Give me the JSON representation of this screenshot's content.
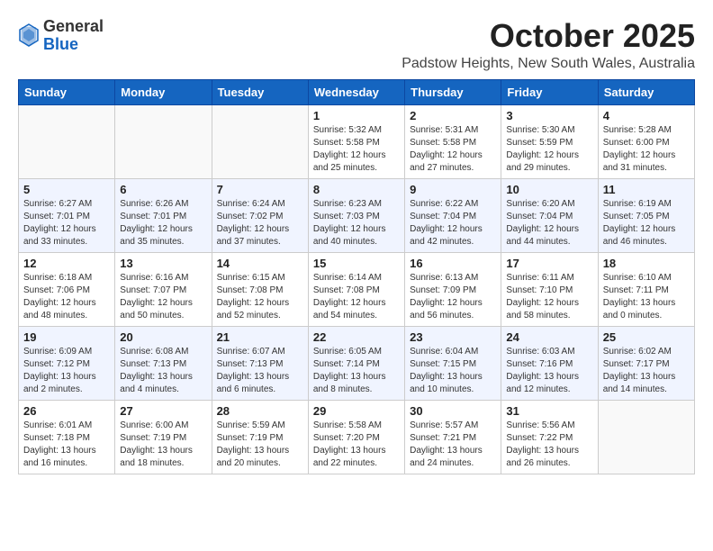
{
  "header": {
    "logo_general": "General",
    "logo_blue": "Blue",
    "month": "October 2025",
    "location": "Padstow Heights, New South Wales, Australia"
  },
  "weekdays": [
    "Sunday",
    "Monday",
    "Tuesday",
    "Wednesday",
    "Thursday",
    "Friday",
    "Saturday"
  ],
  "weeks": [
    [
      {
        "day": "",
        "info": ""
      },
      {
        "day": "",
        "info": ""
      },
      {
        "day": "",
        "info": ""
      },
      {
        "day": "1",
        "info": "Sunrise: 5:32 AM\nSunset: 5:58 PM\nDaylight: 12 hours\nand 25 minutes."
      },
      {
        "day": "2",
        "info": "Sunrise: 5:31 AM\nSunset: 5:58 PM\nDaylight: 12 hours\nand 27 minutes."
      },
      {
        "day": "3",
        "info": "Sunrise: 5:30 AM\nSunset: 5:59 PM\nDaylight: 12 hours\nand 29 minutes."
      },
      {
        "day": "4",
        "info": "Sunrise: 5:28 AM\nSunset: 6:00 PM\nDaylight: 12 hours\nand 31 minutes."
      }
    ],
    [
      {
        "day": "5",
        "info": "Sunrise: 6:27 AM\nSunset: 7:01 PM\nDaylight: 12 hours\nand 33 minutes."
      },
      {
        "day": "6",
        "info": "Sunrise: 6:26 AM\nSunset: 7:01 PM\nDaylight: 12 hours\nand 35 minutes."
      },
      {
        "day": "7",
        "info": "Sunrise: 6:24 AM\nSunset: 7:02 PM\nDaylight: 12 hours\nand 37 minutes."
      },
      {
        "day": "8",
        "info": "Sunrise: 6:23 AM\nSunset: 7:03 PM\nDaylight: 12 hours\nand 40 minutes."
      },
      {
        "day": "9",
        "info": "Sunrise: 6:22 AM\nSunset: 7:04 PM\nDaylight: 12 hours\nand 42 minutes."
      },
      {
        "day": "10",
        "info": "Sunrise: 6:20 AM\nSunset: 7:04 PM\nDaylight: 12 hours\nand 44 minutes."
      },
      {
        "day": "11",
        "info": "Sunrise: 6:19 AM\nSunset: 7:05 PM\nDaylight: 12 hours\nand 46 minutes."
      }
    ],
    [
      {
        "day": "12",
        "info": "Sunrise: 6:18 AM\nSunset: 7:06 PM\nDaylight: 12 hours\nand 48 minutes."
      },
      {
        "day": "13",
        "info": "Sunrise: 6:16 AM\nSunset: 7:07 PM\nDaylight: 12 hours\nand 50 minutes."
      },
      {
        "day": "14",
        "info": "Sunrise: 6:15 AM\nSunset: 7:08 PM\nDaylight: 12 hours\nand 52 minutes."
      },
      {
        "day": "15",
        "info": "Sunrise: 6:14 AM\nSunset: 7:08 PM\nDaylight: 12 hours\nand 54 minutes."
      },
      {
        "day": "16",
        "info": "Sunrise: 6:13 AM\nSunset: 7:09 PM\nDaylight: 12 hours\nand 56 minutes."
      },
      {
        "day": "17",
        "info": "Sunrise: 6:11 AM\nSunset: 7:10 PM\nDaylight: 12 hours\nand 58 minutes."
      },
      {
        "day": "18",
        "info": "Sunrise: 6:10 AM\nSunset: 7:11 PM\nDaylight: 13 hours\nand 0 minutes."
      }
    ],
    [
      {
        "day": "19",
        "info": "Sunrise: 6:09 AM\nSunset: 7:12 PM\nDaylight: 13 hours\nand 2 minutes."
      },
      {
        "day": "20",
        "info": "Sunrise: 6:08 AM\nSunset: 7:13 PM\nDaylight: 13 hours\nand 4 minutes."
      },
      {
        "day": "21",
        "info": "Sunrise: 6:07 AM\nSunset: 7:13 PM\nDaylight: 13 hours\nand 6 minutes."
      },
      {
        "day": "22",
        "info": "Sunrise: 6:05 AM\nSunset: 7:14 PM\nDaylight: 13 hours\nand 8 minutes."
      },
      {
        "day": "23",
        "info": "Sunrise: 6:04 AM\nSunset: 7:15 PM\nDaylight: 13 hours\nand 10 minutes."
      },
      {
        "day": "24",
        "info": "Sunrise: 6:03 AM\nSunset: 7:16 PM\nDaylight: 13 hours\nand 12 minutes."
      },
      {
        "day": "25",
        "info": "Sunrise: 6:02 AM\nSunset: 7:17 PM\nDaylight: 13 hours\nand 14 minutes."
      }
    ],
    [
      {
        "day": "26",
        "info": "Sunrise: 6:01 AM\nSunset: 7:18 PM\nDaylight: 13 hours\nand 16 minutes."
      },
      {
        "day": "27",
        "info": "Sunrise: 6:00 AM\nSunset: 7:19 PM\nDaylight: 13 hours\nand 18 minutes."
      },
      {
        "day": "28",
        "info": "Sunrise: 5:59 AM\nSunset: 7:19 PM\nDaylight: 13 hours\nand 20 minutes."
      },
      {
        "day": "29",
        "info": "Sunrise: 5:58 AM\nSunset: 7:20 PM\nDaylight: 13 hours\nand 22 minutes."
      },
      {
        "day": "30",
        "info": "Sunrise: 5:57 AM\nSunset: 7:21 PM\nDaylight: 13 hours\nand 24 minutes."
      },
      {
        "day": "31",
        "info": "Sunrise: 5:56 AM\nSunset: 7:22 PM\nDaylight: 13 hours\nand 26 minutes."
      },
      {
        "day": "",
        "info": ""
      }
    ]
  ]
}
